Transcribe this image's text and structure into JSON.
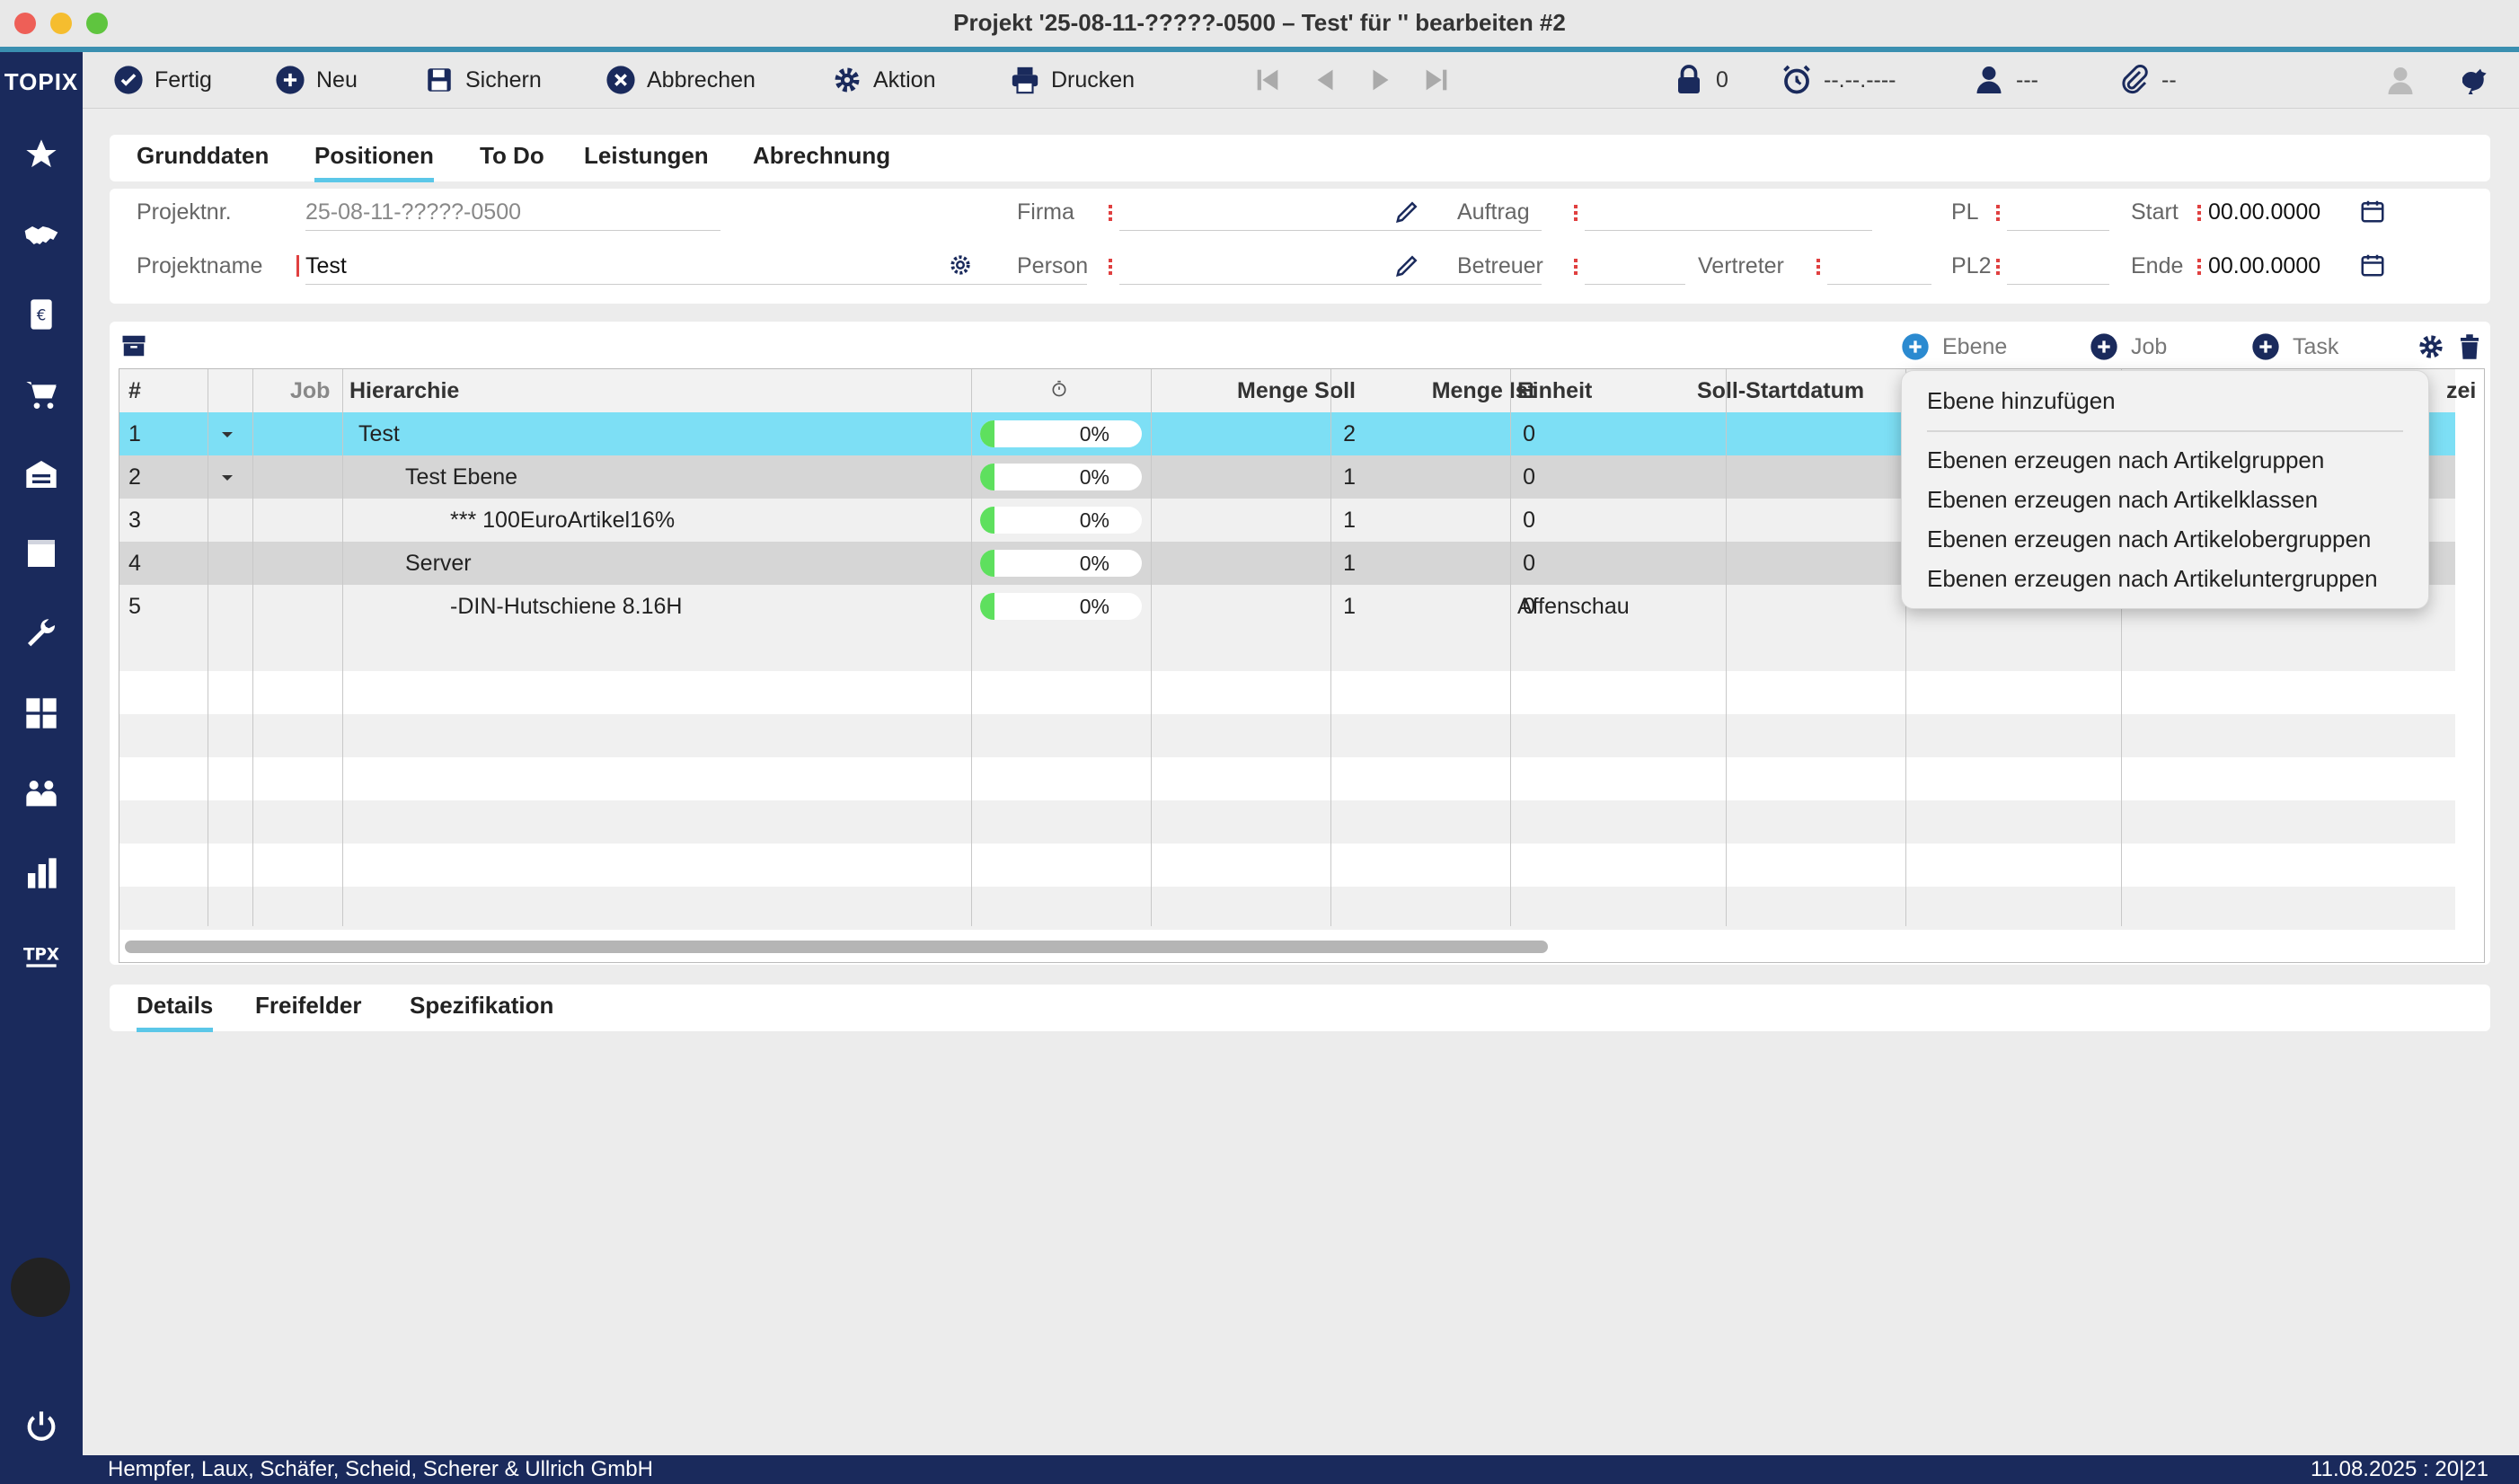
{
  "window": {
    "title": "Projekt '25-08-11-?????-0500 – Test' für '' bearbeiten #2"
  },
  "app": {
    "logo": "TOPIX",
    "accent": "#5bc7e8",
    "sidebar_color": "#1a2a5c"
  },
  "sidebar": {
    "icons": [
      "star-icon",
      "handshake-icon",
      "invoice-icon",
      "cart-icon",
      "warehouse-icon",
      "box-icon",
      "wrench-icon",
      "calculator-icon",
      "people-icon",
      "bar-chart-icon",
      "tpx-icon"
    ]
  },
  "toolbar": {
    "done": "Fertig",
    "new": "Neu",
    "save": "Sichern",
    "cancel": "Abbrechen",
    "action": "Aktion",
    "print": "Drucken",
    "lock_count": "0",
    "alarm_date": "--.--.----",
    "user": "---",
    "attachments": "--"
  },
  "tabs": [
    "Grunddaten",
    "Positionen",
    "To Do",
    "Leistungen",
    "Abrechnung"
  ],
  "form": {
    "projektnr_label": "Projektnr.",
    "projektnr_value": "25-08-11-?????-0500",
    "projektname_label": "Projektname",
    "projektname_value": "Test",
    "firma_label": "Firma",
    "person_label": "Person",
    "auftrag_label": "Auftrag",
    "betreuer_label": "Betreuer",
    "vertreter_label": "Vertreter",
    "pl_label": "PL",
    "pl2_label": "PL2",
    "start_label": "Start",
    "start_value": "00.00.0000",
    "ende_label": "Ende",
    "ende_value": "00.00.0000"
  },
  "grid_toolbar": {
    "ebene": "Ebene",
    "job": "Job",
    "task": "Task"
  },
  "grid": {
    "headers": {
      "num": "#",
      "job": "Job",
      "hier": "Hierarchie",
      "soll": "Menge Soll",
      "ist": "Menge Ist",
      "einheit": "Einheit",
      "start": "Soll-Startdatum",
      "trunc": "zei"
    },
    "rows": [
      {
        "num": "1",
        "name": "Test",
        "progress": "0%",
        "soll": "2",
        "ist": "0",
        "einheit": ""
      },
      {
        "num": "2",
        "name": "Test Ebene",
        "progress": "0%",
        "soll": "1",
        "ist": "0",
        "einheit": ""
      },
      {
        "num": "3",
        "name": "*** 100EuroArtikel16%",
        "progress": "0%",
        "soll": "1",
        "ist": "0",
        "einheit": ""
      },
      {
        "num": "4",
        "name": "Server",
        "progress": "0%",
        "soll": "1",
        "ist": "0",
        "einheit": ""
      },
      {
        "num": "5",
        "name": "-DIN-Hutschiene 8.16H",
        "progress": "0%",
        "soll": "1",
        "ist": "0",
        "einheit": "Affenschau"
      }
    ]
  },
  "menu": {
    "add": "Ebene hinzufügen",
    "items": [
      "Ebenen erzeugen nach Artikelgruppen",
      "Ebenen erzeugen nach Artikelklassen",
      "Ebenen erzeugen nach Artikelobergruppen",
      "Ebenen erzeugen nach Artikeluntergruppen"
    ]
  },
  "bottom_tabs": [
    "Details",
    "Freifelder",
    "Spezifikation"
  ],
  "footer": {
    "company": "Hempfer, Laux, Schäfer, Scheid, Scherer & Ullrich GmbH",
    "datetime": "11.08.2025 : 20|21"
  }
}
